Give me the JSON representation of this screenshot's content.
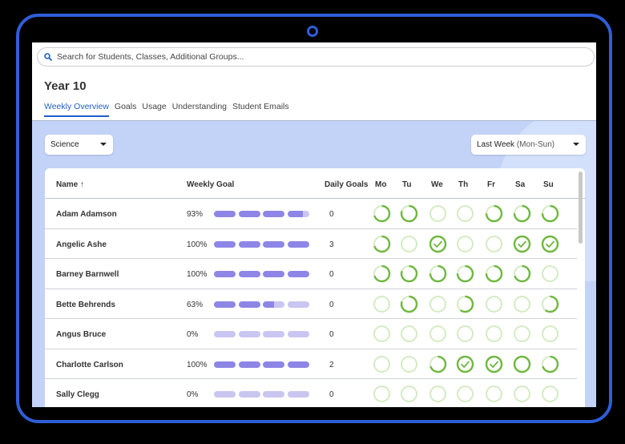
{
  "search": {
    "placeholder": "Search for Students, Classes, Additional Groups..."
  },
  "page_title": "Year 10",
  "tabs": [
    {
      "label": "Weekly Overview",
      "active": true
    },
    {
      "label": "Goals",
      "active": false
    },
    {
      "label": "Usage",
      "active": false
    },
    {
      "label": "Understanding",
      "active": false
    },
    {
      "label": "Student Emails",
      "active": false
    }
  ],
  "filters": {
    "subject": "Science",
    "period": "Last Week",
    "period_suffix": "(Mon-Sun)"
  },
  "table": {
    "headers": {
      "name": "Name",
      "sort_arrow": "↑",
      "weekly_goal": "Weekly Goal",
      "daily_goals": "Daily Goals"
    },
    "days": [
      "Mo",
      "Tu",
      "We",
      "Th",
      "Fr",
      "Sa",
      "Su"
    ],
    "rows": [
      {
        "name": "Adam Adamson",
        "weekly_pct": "93%",
        "weekly_goal_fraction": 0.93,
        "daily_goals": "0",
        "days": [
          {
            "p": 0.7,
            "c": false
          },
          {
            "p": 0.8,
            "c": false
          },
          {
            "p": 0,
            "c": false
          },
          {
            "p": 0,
            "c": false
          },
          {
            "p": 0.75,
            "c": false
          },
          {
            "p": 0.75,
            "c": false
          },
          {
            "p": 0.75,
            "c": false
          }
        ]
      },
      {
        "name": "Angelic Ashe",
        "weekly_pct": "100%",
        "weekly_goal_fraction": 1.0,
        "daily_goals": "3",
        "days": [
          {
            "p": 0.7,
            "c": false
          },
          {
            "p": 0,
            "c": false
          },
          {
            "p": 1,
            "c": true
          },
          {
            "p": 0,
            "c": false
          },
          {
            "p": 0,
            "c": false
          },
          {
            "p": 1,
            "c": true
          },
          {
            "p": 1,
            "c": true
          }
        ]
      },
      {
        "name": "Barney Barnwell",
        "weekly_pct": "100%",
        "weekly_goal_fraction": 1.0,
        "daily_goals": "0",
        "days": [
          {
            "p": 0.7,
            "c": false
          },
          {
            "p": 0.8,
            "c": false
          },
          {
            "p": 0.75,
            "c": false
          },
          {
            "p": 0.75,
            "c": false
          },
          {
            "p": 0.75,
            "c": false
          },
          {
            "p": 0.7,
            "c": false
          },
          {
            "p": 0,
            "c": false
          }
        ]
      },
      {
        "name": "Bette Behrends",
        "weekly_pct": "63%",
        "weekly_goal_fraction": 0.63,
        "daily_goals": "0",
        "days": [
          {
            "p": 0,
            "c": false
          },
          {
            "p": 0.8,
            "c": false
          },
          {
            "p": 0,
            "c": false
          },
          {
            "p": 0.6,
            "c": false
          },
          {
            "p": 0,
            "c": false
          },
          {
            "p": 0,
            "c": false
          },
          {
            "p": 0.6,
            "c": false
          }
        ]
      },
      {
        "name": "Angus Bruce",
        "weekly_pct": "0%",
        "weekly_goal_fraction": 0.0,
        "daily_goals": "0",
        "days": [
          {
            "p": 0,
            "c": false
          },
          {
            "p": 0,
            "c": false
          },
          {
            "p": 0,
            "c": false
          },
          {
            "p": 0,
            "c": false
          },
          {
            "p": 0,
            "c": false
          },
          {
            "p": 0,
            "c": false
          },
          {
            "p": 0,
            "c": false
          }
        ]
      },
      {
        "name": "Charlotte Carlson",
        "weekly_pct": "100%",
        "weekly_goal_fraction": 1.0,
        "daily_goals": "2",
        "days": [
          {
            "p": 0,
            "c": false
          },
          {
            "p": 0,
            "c": false
          },
          {
            "p": 0.7,
            "c": false
          },
          {
            "p": 1,
            "c": true
          },
          {
            "p": 1,
            "c": true
          },
          {
            "p": 1,
            "c": false
          },
          {
            "p": 0.7,
            "c": false
          }
        ]
      },
      {
        "name": "Sally Clegg",
        "weekly_pct": "0%",
        "weekly_goal_fraction": 0.0,
        "daily_goals": "0",
        "days": [
          {
            "p": 0,
            "c": false
          },
          {
            "p": 0,
            "c": false
          },
          {
            "p": 0,
            "c": false
          },
          {
            "p": 0,
            "c": false
          },
          {
            "p": 0,
            "c": false
          },
          {
            "p": 0,
            "c": false
          },
          {
            "p": 0,
            "c": false
          }
        ]
      }
    ]
  },
  "colors": {
    "frame": "#2f5ed8",
    "accent": "#1f5fc7",
    "bar_fill": "#8d86e6",
    "bar_empty": "#c9c6f1",
    "ring_active": "#6fb83f",
    "ring_inactive": "#d4ebc3",
    "background": "#c3d3f7"
  },
  "icons": {
    "search": "search-icon",
    "sort": "sort-ascending-icon",
    "caret": "chevron-down-icon",
    "check": "check-icon"
  }
}
